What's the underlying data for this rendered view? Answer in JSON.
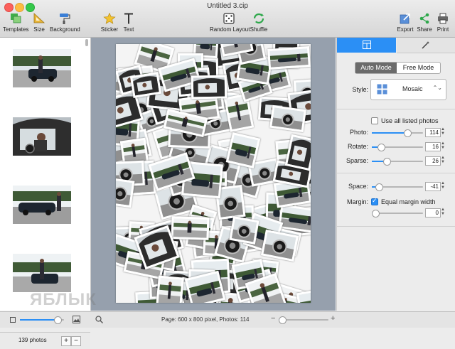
{
  "window": {
    "title": "Untitled 3.cip"
  },
  "toolbar": {
    "templates": "Templates",
    "size": "Size",
    "background": "Background",
    "sticker": "Sticker",
    "text": "Text",
    "random_layout": "Random Layout",
    "shuffle": "Shuffle",
    "export": "Export",
    "share": "Share",
    "print": "Print"
  },
  "left_panel": {
    "photo_count": "139 photos",
    "add_label": "+",
    "remove_label": "−",
    "thumbnails": [
      "car-girl-1",
      "car-girl-2",
      "car-girl-3",
      "car-girl-4"
    ]
  },
  "panel": {
    "mode_auto": "Auto Mode",
    "mode_free": "Free Mode",
    "style_label": "Style:",
    "style_value": "Mosaic",
    "use_all_label": "Use all listed photos",
    "use_all_checked": false,
    "photo_label": "Photo:",
    "photo_value": "114",
    "photo_fraction": 0.72,
    "rotate_label": "Rotate:",
    "rotate_value": "16",
    "rotate_fraction": 0.12,
    "sparse_label": "Sparse:",
    "sparse_value": "26",
    "sparse_fraction": 0.26,
    "space_label": "Space:",
    "space_value": "-41",
    "space_fraction": 0.08,
    "margin_label": "Margin:",
    "equal_margin_label": "Equal margin width",
    "equal_margin_checked": true,
    "margin_value": "0",
    "margin_fraction": 0.0
  },
  "status": {
    "text": "Page: 600 x 800 pixel, Photos: 114"
  },
  "watermark": "ЯБЛЫК",
  "colors": {
    "accent": "#2b8ff5",
    "canvas_bg": "#96a0ad"
  }
}
